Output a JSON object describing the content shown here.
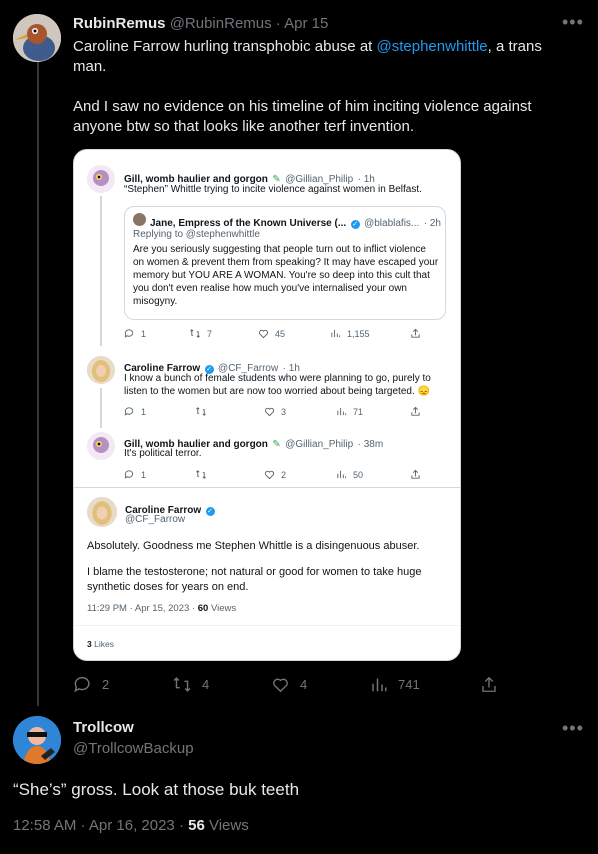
{
  "tweet1": {
    "name": "RubinRemus",
    "handle": "@RubinRemus",
    "sep": "·",
    "date": "Apr 15",
    "text_pre": "Caroline Farrow hurling transphobic abuse at ",
    "mention": "@stephenwhittle",
    "text_post": ", a trans man.",
    "text2": "And I saw no evidence on his timeline of him inciting violence against anyone btw so that looks like another terf invention.",
    "actions": {
      "replies": "2",
      "retweets": "4",
      "likes": "4",
      "views": "741"
    }
  },
  "embedded": {
    "post1": {
      "name": "Gill, womb haulier and gorgon",
      "handle": "@Gillian_Philip",
      "time": "· 1h",
      "text": "“Stephen” Whittle trying to incite violence against women in Belfast.",
      "quote": {
        "name": "Jane, Empress of the Known Universe (...",
        "handle": "@blablafis...",
        "time": "· 2h",
        "replying": "Replying to @stephenwhittle",
        "text": "Are you seriously suggesting that people turn out to inflict violence on women & prevent them from speaking? It may have escaped your memory but YOU ARE A WOMAN. You're so deep into this cult that you don't even realise how much you've internalised your own misogyny."
      },
      "actions": {
        "replies": "1",
        "retweets": "7",
        "likes": "45",
        "views": "1,155"
      }
    },
    "post2": {
      "name": "Caroline Farrow",
      "handle": "@CF_Farrow",
      "time": "· 1h",
      "text": "I know a bunch of female students who were planning to go, purely to listen to the women but are now too worried about being targeted. 😞",
      "actions": {
        "replies": "1",
        "likes": "3",
        "views": "71"
      }
    },
    "post3": {
      "name": "Gill, womb haulier and gorgon",
      "handle": "@Gillian_Philip",
      "time": "· 38m",
      "text": "It's political terror.",
      "actions": {
        "replies": "1",
        "likes": "2",
        "views": "50"
      }
    },
    "main": {
      "name": "Caroline Farrow",
      "handle": "@CF_Farrow",
      "text1": "Absolutely. Goodness me Stephen Whittle is a disingenuous abuser.",
      "text2": "I blame the testosterone; not natural or good for women to take huge synthetic doses for years on end.",
      "timestamp": "11:29 PM · Apr 15, 2023 ·",
      "views_count": "60",
      "views_label": "Views",
      "likes_count": "3",
      "likes_label": "Likes"
    }
  },
  "tweet2": {
    "name": "Trollcow",
    "handle": "@TrollcowBackup",
    "text": "“She’s” gross. Look at those buk teeth",
    "timestamp": "12:58 AM · Apr 16, 2023 ·",
    "views_count": "56",
    "views_label": "Views"
  },
  "colors": {
    "background": "#000000",
    "text": "#e7e9ea",
    "muted": "#71767b",
    "link": "#1d9bf0",
    "verified": "#1d9bf0"
  }
}
